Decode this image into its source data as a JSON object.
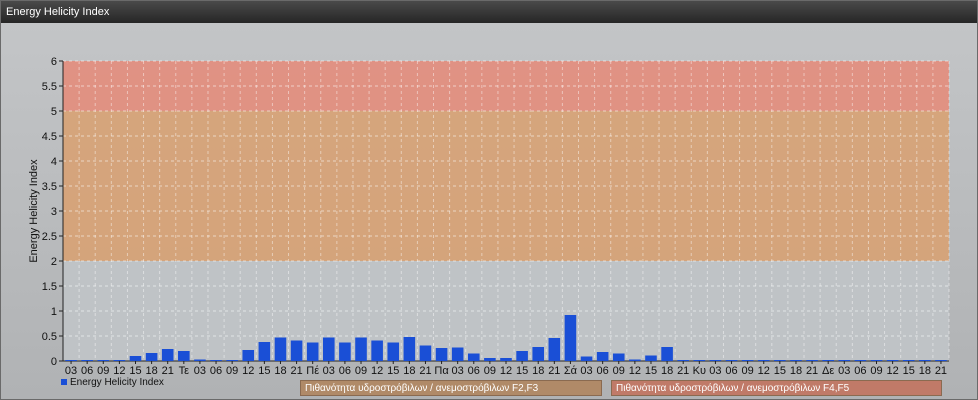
{
  "window": {
    "title": "Energy Helicity Index"
  },
  "chart_data": {
    "type": "bar",
    "ylabel": "Energy Helicity Index",
    "ylim": [
      0,
      6
    ],
    "yticks": [
      "0",
      "0.5",
      "1",
      "1.5",
      "2",
      "2.5",
      "3",
      "3.5",
      "4",
      "4.5",
      "5",
      "5.5",
      "6"
    ],
    "categories": [
      "03",
      "06",
      "09",
      "12",
      "15",
      "18",
      "21",
      "Τε",
      "03",
      "06",
      "09",
      "12",
      "15",
      "18",
      "21",
      "Πέ",
      "03",
      "06",
      "09",
      "12",
      "15",
      "18",
      "21",
      "Πα",
      "03",
      "06",
      "09",
      "12",
      "15",
      "18",
      "21",
      "Σά",
      "03",
      "06",
      "09",
      "12",
      "15",
      "18",
      "21",
      "Κυ",
      "03",
      "06",
      "09",
      "12",
      "15",
      "18",
      "21",
      "Δε",
      "03",
      "06",
      "09",
      "12",
      "15",
      "18",
      "21"
    ],
    "series": [
      {
        "name": "Energy Helicity Index",
        "color": "#1a4fd6",
        "values": [
          0.01,
          0.01,
          0.01,
          0.02,
          0.1,
          0.16,
          0.24,
          0.2,
          0.03,
          0.02,
          0.02,
          0.22,
          0.38,
          0.47,
          0.41,
          0.37,
          0.47,
          0.37,
          0.47,
          0.41,
          0.37,
          0.48,
          0.31,
          0.26,
          0.27,
          0.15,
          0.06,
          0.06,
          0.2,
          0.28,
          0.46,
          0.92,
          0.09,
          0.18,
          0.15,
          0.03,
          0.11,
          0.28,
          0.02,
          0.01,
          0.01,
          0.01,
          0.01,
          0.01,
          0.01,
          0.01,
          0.01,
          0.01,
          0.01,
          0.01,
          0.01,
          0.01,
          0.01,
          0.01,
          0.01
        ]
      }
    ],
    "bands": [
      {
        "label": "Πιθανότητα υδροστρόβιλων / ανεμοστρόβιλων F2,F3",
        "from": 2,
        "to": 5,
        "color": "#d9a070"
      },
      {
        "label": "Πιθανότητα υδροστρόβιλων / ανεμοστρόβιλων F4,F5",
        "from": 5,
        "to": 6,
        "color": "#e58a78"
      }
    ],
    "grid": true,
    "legend": "bottom-left"
  }
}
